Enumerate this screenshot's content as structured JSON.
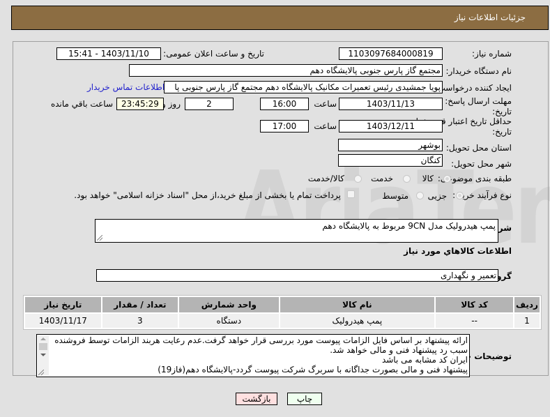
{
  "header": {
    "title": "جزئیات اطلاعات نیاز"
  },
  "fields": {
    "need_number": {
      "label": "شماره نیاز:",
      "value": "1103097684000819"
    },
    "announce_datetime": {
      "label": "تاریخ و ساعت اعلان عمومی:",
      "value": "1403/11/10 - 15:41"
    },
    "buyer_org": {
      "label": "نام دستگاه خریدار:",
      "value": "مجتمع گاز پارس جنوبی  پالایشگاه دهم"
    },
    "requester": {
      "label": "ایجاد کننده درخواست:",
      "value": "پویا جمشیدی رئیس تعمیرات مکانیک پالایشگاه دهم  مجتمع گاز پارس جنوبی  پا"
    },
    "buyer_contact_link": "اطلاعات تماس خریدار",
    "response_deadline": {
      "label": "مهلت ارسال پاسخ: تا تاریخ:",
      "date": "1403/11/13",
      "time_label": "ساعت",
      "time": "16:00",
      "days": "2",
      "days_label": "روز و",
      "remaining": "23:45:29",
      "remaining_label": "ساعت باقي مانده"
    },
    "price_validity": {
      "label": "حداقل تاریخ اعتبار قیمت: تا تاریخ:",
      "date": "1403/12/11",
      "time_label": "ساعت",
      "time": "17:00"
    },
    "delivery_province": {
      "label": "استان محل تحویل:",
      "value": "بوشهر"
    },
    "delivery_city": {
      "label": "شهر محل تحویل:",
      "value": "کنگان"
    },
    "category": {
      "label": "طبقه بندی موضوعی:",
      "options": [
        "کالا",
        "خدمت",
        "کالا/خدمت"
      ],
      "selected": "کالا"
    },
    "purchase_process": {
      "label": "نوع فرآیند خرید :",
      "options": [
        "جزیی",
        "متوسط"
      ],
      "selected": "جزیی",
      "treasury_checkbox_label": "پرداخت تمام یا بخشی از مبلغ خرید،از محل \"اسناد خزانه اسلامی\" خواهد بود.",
      "treasury_checked": false
    },
    "general_description": {
      "label": "شرح کلي نياز:",
      "value": "پمپ هیدرولیک مدل 9CN مربوط به پالایشگاه دهم"
    }
  },
  "goods_section": {
    "title": "اطلاعات کالاهاي مورد نياز",
    "group_label": "گروه کالا:",
    "group_value": "تعمیر و نگهداری",
    "table": {
      "headers": [
        "ردیف",
        "کد کالا",
        "نام کالا",
        "واحد شمارش",
        "تعداد / مقدار",
        "تاریخ نیاز"
      ],
      "rows": [
        [
          "1",
          "--",
          "پمپ هیدرولیک",
          "دستگاه",
          "3",
          "1403/11/17"
        ]
      ]
    }
  },
  "buyer_notes": {
    "label": "توضیحات خریدار:",
    "lines": [
      "ارائه پیشنهاد بر اساس فایل الزامات پیوست مورد بررسی قرار خواهد گرفت.عدم رعایت هربند الزامات توسط فروشنده",
      "سبب رد پیشنهاد فنی و مالی خواهد شد.",
      "ایران کد مشابه می باشد",
      "پیشنهاد فنی و مالی بصورت جداگانه با سربرگ شرکت پیوست گردد-پالایشگاه دهم(فاز19)"
    ]
  },
  "buttons": {
    "print": "چاپ",
    "back": "بازگشت"
  },
  "watermark": "AriaTender.net",
  "colors": {
    "header_bg": "#8c6d42",
    "print_bg": "#efffef",
    "back_bg": "#ffe0e0",
    "link": "#2222cc"
  }
}
